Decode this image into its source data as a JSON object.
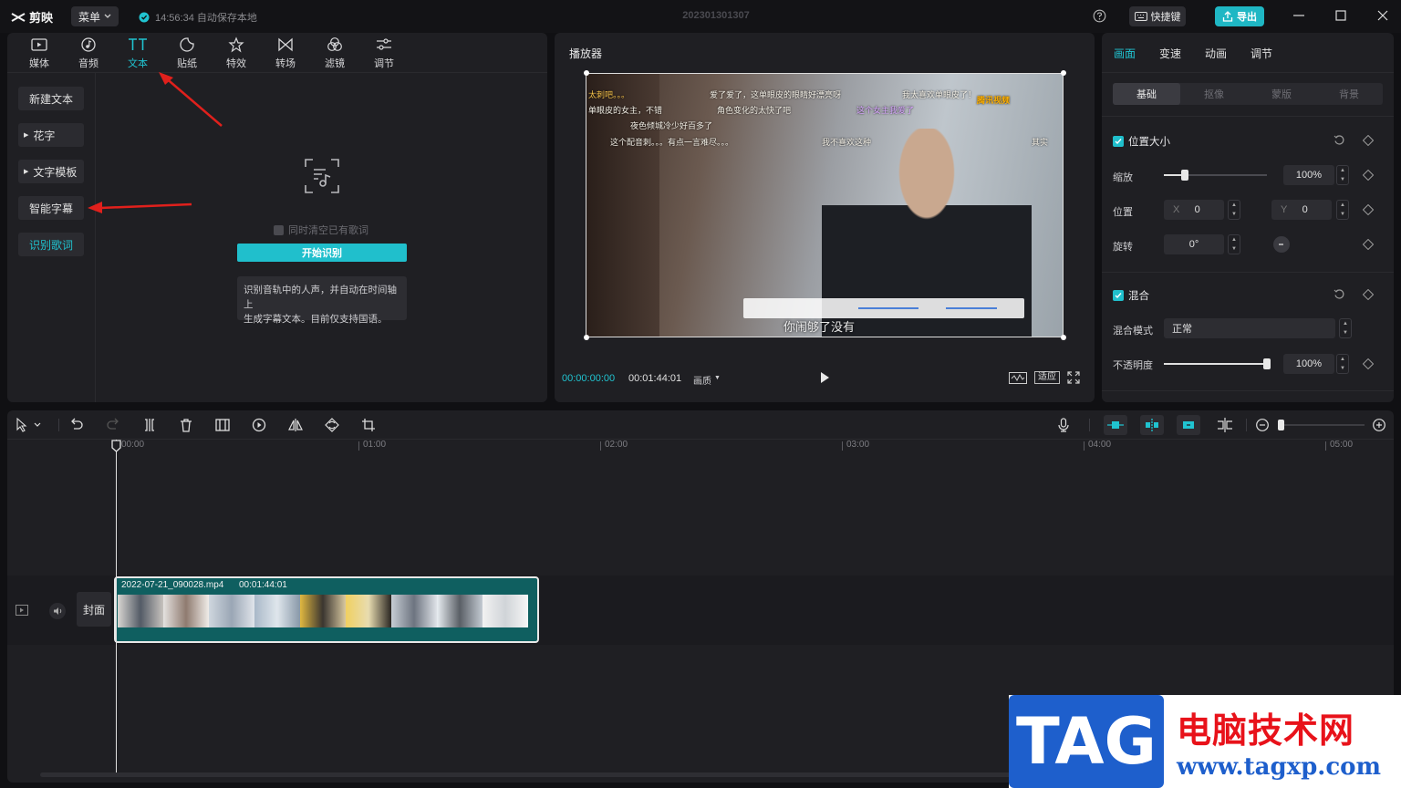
{
  "app": {
    "logo_text": "剪映",
    "menu_label": "菜单",
    "autosave_text": "14:56:34 自动保存本地",
    "project_title": "202301301307",
    "shortcut_label": "快捷键",
    "export_label": "导出"
  },
  "left_tabs": [
    {
      "label": "媒体",
      "icon": "media-icon"
    },
    {
      "label": "音频",
      "icon": "audio-icon"
    },
    {
      "label": "文本",
      "icon": "text-icon"
    },
    {
      "label": "贴纸",
      "icon": "sticker-icon"
    },
    {
      "label": "特效",
      "icon": "effects-icon"
    },
    {
      "label": "转场",
      "icon": "transition-icon"
    },
    {
      "label": "滤镜",
      "icon": "filter-icon"
    },
    {
      "label": "调节",
      "icon": "adjust-icon"
    }
  ],
  "active_left_tab": "文本",
  "text_sidebar": [
    "新建文本",
    "花字",
    "文字模板",
    "智能字幕",
    "识别歌词"
  ],
  "text_sidebar_active": "识别歌词",
  "lyrics_panel": {
    "clear_checkbox_label": "同时清空已有歌词",
    "start_button": "开始识别",
    "tip_line1": "识别音轨中的人声，并自动在时间轴上",
    "tip_line2": "生成字幕文本。目前仅支持国语。"
  },
  "player": {
    "title": "播放器",
    "current_time": "00:00:00:00",
    "total_time": "00:01:44:01",
    "quality_label": "画质",
    "fit_label": "适应",
    "subtitle": "你闹够了没有",
    "danmu": [
      "太刺吧。。。",
      "爱了爱了，这单眼皮的眼睛好漂亮呀",
      "我太喜欢单眼皮了！",
      "这个女主我爱了",
      "单眼皮的女主，不错",
      "角色变化的太快了吧",
      "腾讯视频",
      "夜色倾城冷少好百多了",
      "这个配音刺。。。有点一言难尽。。。",
      "我不喜欢这种",
      "其实"
    ]
  },
  "properties": {
    "tabs": [
      "画面",
      "变速",
      "动画",
      "调节"
    ],
    "active_tab": "画面",
    "subtabs": [
      "基础",
      "抠像",
      "蒙版",
      "背景"
    ],
    "active_subtab": "基础",
    "pos_size": {
      "title": "位置大小",
      "scale_label": "缩放",
      "scale_value": "100%",
      "scale_level": 0.2,
      "position_label": "位置",
      "x_label": "X",
      "x_value": "0",
      "y_label": "Y",
      "y_value": "0",
      "rotate_label": "旋转",
      "rotate_value": "0°"
    },
    "blend": {
      "title": "混合",
      "mode_label": "混合模式",
      "mode_value": "正常",
      "opacity_label": "不透明度",
      "opacity_value": "100%",
      "opacity_level": 1.0
    }
  },
  "timeline": {
    "ruler_labels": [
      "00:00",
      "01:00",
      "02:00",
      "03:00",
      "04:00",
      "05:00"
    ],
    "cover_label": "封面",
    "clip_name": "2022-07-21_090028.mp4",
    "clip_duration": "00:01:44:01"
  },
  "watermark": {
    "tag": "TAG",
    "site_name": "电脑技术网",
    "url": "www.tagxp.com"
  },
  "colors": {
    "accent": "#20c3d0",
    "panel": "#1f1f23",
    "background": "#101013",
    "clip": "#0f5f60"
  }
}
